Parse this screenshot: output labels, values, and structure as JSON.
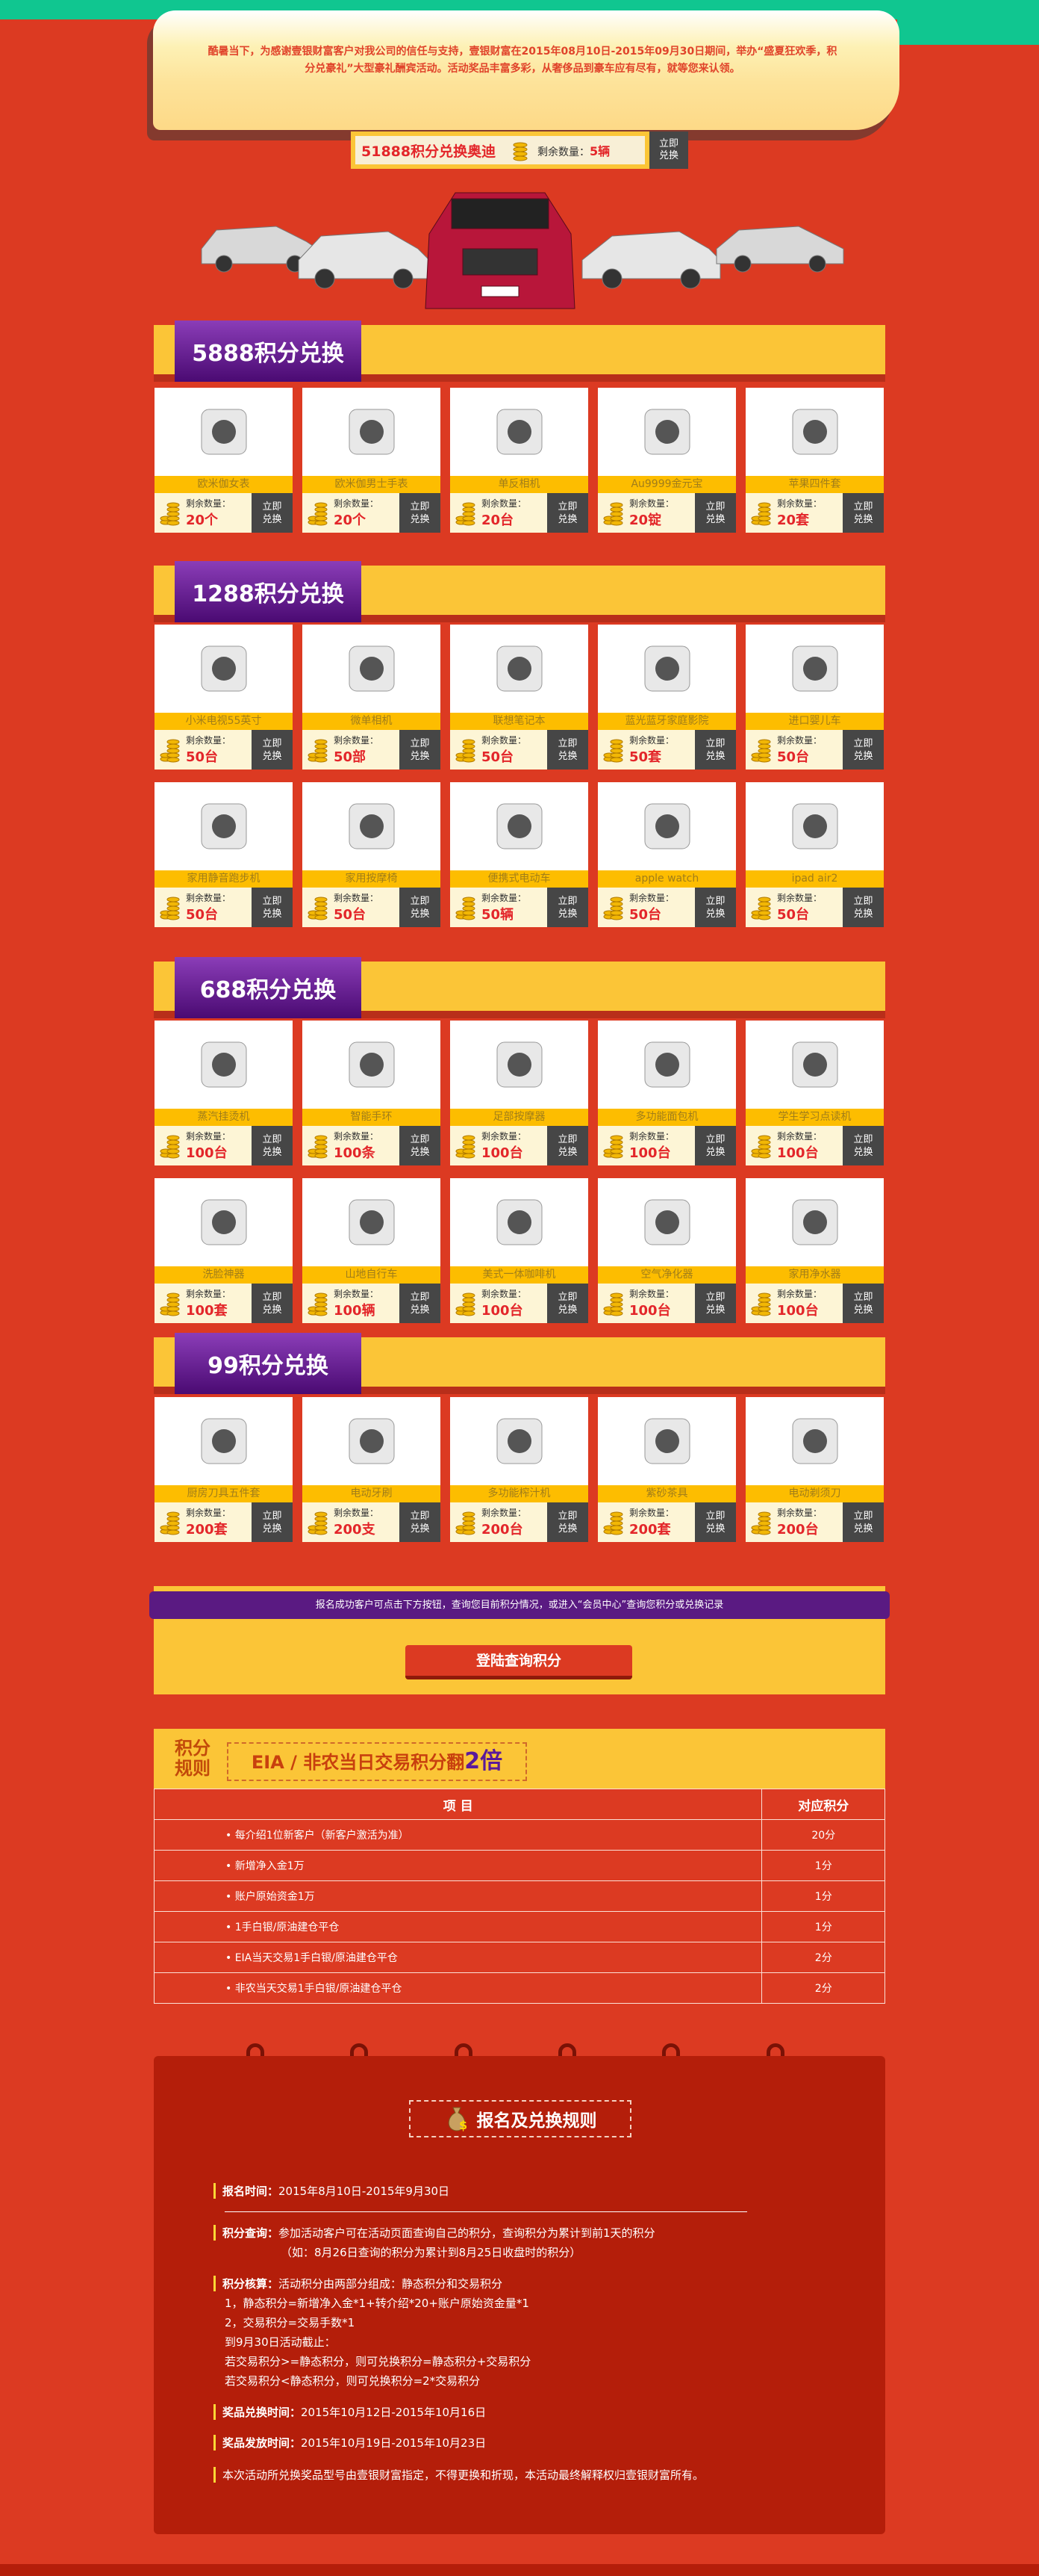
{
  "intro": "酷暑当下，为感谢壹银财富客户对我公司的信任与支持，壹银财富在2015年08月10日-2015年09月30日期间，举办“盛夏狂欢季，积分兑豪礼”大型豪礼酬宾活动。活动奖品丰富多彩，从奢侈品到豪车应有尽有，就等您来认领。",
  "hero": {
    "title": "51888积分兑换奥迪",
    "remain_label": "剩余数量：",
    "remain": "5辆",
    "button": "立即兑换"
  },
  "remain_label": "剩余数量：",
  "exchange_label": "立即兑换",
  "sections": [
    {
      "title": "5888积分兑换",
      "items": [
        [
          "欧米伽女表",
          "20个"
        ],
        [
          "欧米伽男士手表",
          "20个"
        ],
        [
          "单反相机",
          "20台"
        ],
        [
          "Au9999金元宝",
          "20锭"
        ],
        [
          "苹果四件套",
          "20套"
        ]
      ]
    },
    {
      "title": "1288积分兑换",
      "items": [
        [
          "小米电视55英寸",
          "50台"
        ],
        [
          "微单相机",
          "50部"
        ],
        [
          "联想笔记本",
          "50台"
        ],
        [
          "蓝光蓝牙家庭影院",
          "50套"
        ],
        [
          "进口婴儿车",
          "50台"
        ],
        [
          "家用静音跑步机",
          "50台"
        ],
        [
          "家用按摩椅",
          "50台"
        ],
        [
          "便携式电动车",
          "50辆"
        ],
        [
          "apple watch",
          "50台"
        ],
        [
          "ipad air2",
          "50台"
        ]
      ]
    },
    {
      "title": "688积分兑换",
      "items": [
        [
          "蒸汽挂烫机",
          "100台"
        ],
        [
          "智能手环",
          "100条"
        ],
        [
          "足部按摩器",
          "100台"
        ],
        [
          "多功能面包机",
          "100台"
        ],
        [
          "学生学习点读机",
          "100台"
        ],
        [
          "洗脸神器",
          "100套"
        ],
        [
          "山地自行车",
          "100辆"
        ],
        [
          "美式一体咖啡机",
          "100台"
        ],
        [
          "空气净化器",
          "100台"
        ],
        [
          "家用净水器",
          "100台"
        ]
      ]
    },
    {
      "title": "99积分兑换",
      "items": [
        [
          "厨房刀具五件套",
          "200套"
        ],
        [
          "电动牙刷",
          "200支"
        ],
        [
          "多功能榨汁机",
          "200台"
        ],
        [
          "紫砂茶具",
          "200套"
        ],
        [
          "电动剃须刀",
          "200台"
        ]
      ]
    }
  ],
  "query": {
    "notice": "报名成功客户可点击下方按钮，查询您目前积分情况，或进入“会员中心”查询您积分或兑换记录",
    "button": "登陆查询积分"
  },
  "rules": {
    "label": "积分规则",
    "slogan": "EIA / 非农当日交易积分翻",
    "slogan_em": "2倍",
    "headers": [
      "项 目",
      "对应积分"
    ],
    "rows": [
      [
        "• 每介绍1位新客户（新客户激活为准）",
        "20分"
      ],
      [
        "• 新增净入金1万",
        "1分"
      ],
      [
        "• 账户原始资金1万",
        "1分"
      ],
      [
        "• 1手白银/原油建仓平仓",
        "1分"
      ],
      [
        "• EIA当天交易1手白银/原油建仓平仓",
        "2分"
      ],
      [
        "• 非农当天交易1手白银/原油建仓平仓",
        "2分"
      ]
    ]
  },
  "reg": {
    "title": "报名及兑换规则",
    "signup_label": "报名时间：",
    "signup": "2015年8月10日-2015年9月30日",
    "query_label": "积分查询：",
    "query": "参加活动客户可在活动页面查询自己的积分，查询积分为累计到前1天的积分",
    "query_note": "（如：8月26日查询的积分为累计到8月25日收盘时的积分）",
    "calc_label": "积分核算：",
    "calc": "活动积分由两部分组成：静态积分和交易积分",
    "calc_lines": [
      "1，静态积分=新增净入金*1+转介绍*20+账户原始资金量*1",
      "2，交易积分=交易手数*1",
      "到9月30日活动截止：",
      "若交易积分>=静态积分，则可兑换积分=静态积分+交易积分",
      "若交易积分<静态积分，则可兑换积分=2*交易积分"
    ],
    "exchange_label": "奖品兑换时间：",
    "exchange": "2015年10月12日-2015年10月16日",
    "delivery_label": "奖品发放时间：",
    "delivery": "2015年10月19日-2015年10月23日",
    "disclaimer": "本次活动所兑换奖品型号由壹银财富指定，不得更换和折现，本活动最终解释权归壹银财富所有。"
  },
  "colors": {
    "bg": "#dc3a22",
    "yellow": "#fbc537",
    "purple": "#4a0a72",
    "dark": "#b41e0a"
  }
}
